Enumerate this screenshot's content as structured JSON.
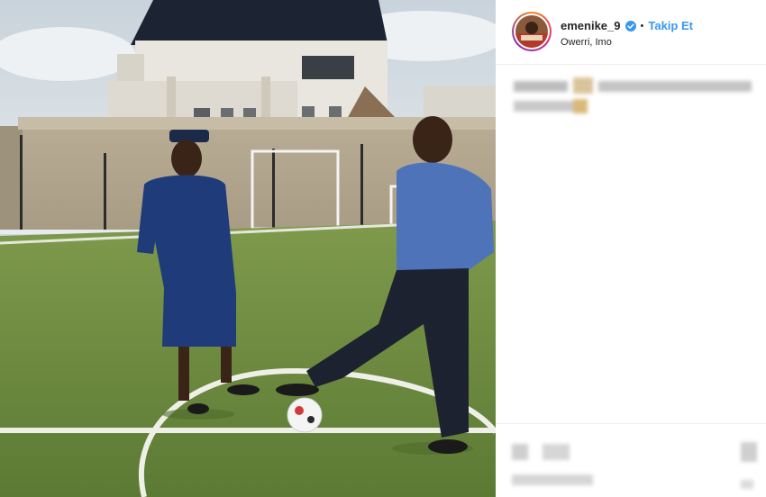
{
  "post": {
    "username": "emenike_9",
    "verified_icon": "verified-badge-icon",
    "separator": "•",
    "follow_label": "Takip Et",
    "location": "Owerri, Imo"
  },
  "colors": {
    "follow": "#3897f0",
    "verified": "#3897f0",
    "text": "#262626",
    "divider": "#efefef"
  }
}
